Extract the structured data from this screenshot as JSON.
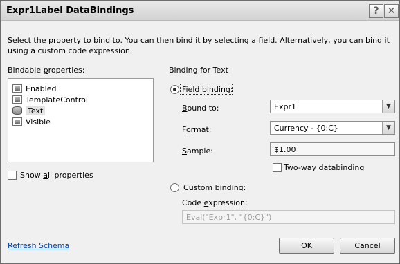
{
  "window": {
    "title": "Expr1Label DataBindings",
    "help_glyph": "?",
    "close_glyph": "✕"
  },
  "description": "Select the property to bind to. You can then bind it by selecting a field. Alternatively, you can bind it using a custom code expression.",
  "bindable": {
    "label_pre": "Bindable ",
    "label_key": "p",
    "label_post": "roperties:",
    "items": [
      {
        "label": "Enabled",
        "icon": "property-icon",
        "selected": false
      },
      {
        "label": "TemplateControl",
        "icon": "property-icon",
        "selected": false
      },
      {
        "label": "Text",
        "icon": "database-icon",
        "selected": true
      },
      {
        "label": "Visible",
        "icon": "property-icon",
        "selected": false
      }
    ],
    "show_all_pre": "Show ",
    "show_all_key": "a",
    "show_all_post": "ll properties",
    "show_all_checked": false
  },
  "binding": {
    "header": "Binding for Text",
    "field_binding_key": "F",
    "field_binding_post": "ield binding:",
    "field_binding_selected": true,
    "bound_to_key": "B",
    "bound_to_post": "ound to:",
    "bound_to_value": "Expr1",
    "format_pre": "F",
    "format_key": "o",
    "format_post": "rmat:",
    "format_value": "Currency - {0:C}",
    "sample_key": "S",
    "sample_post": "ample:",
    "sample_value": "$1.00",
    "two_way_key": "T",
    "two_way_post": "wo-way databinding",
    "two_way_checked": false,
    "custom_key": "C",
    "custom_post": "ustom binding:",
    "custom_selected": false,
    "code_pre": "Code ",
    "code_key": "e",
    "code_post": "xpression:",
    "code_value": "Eval(\"Expr1\", \"{0:C}\")"
  },
  "footer": {
    "refresh_label": "Refresh Schema",
    "ok_label": "OK",
    "cancel_label": "Cancel"
  }
}
